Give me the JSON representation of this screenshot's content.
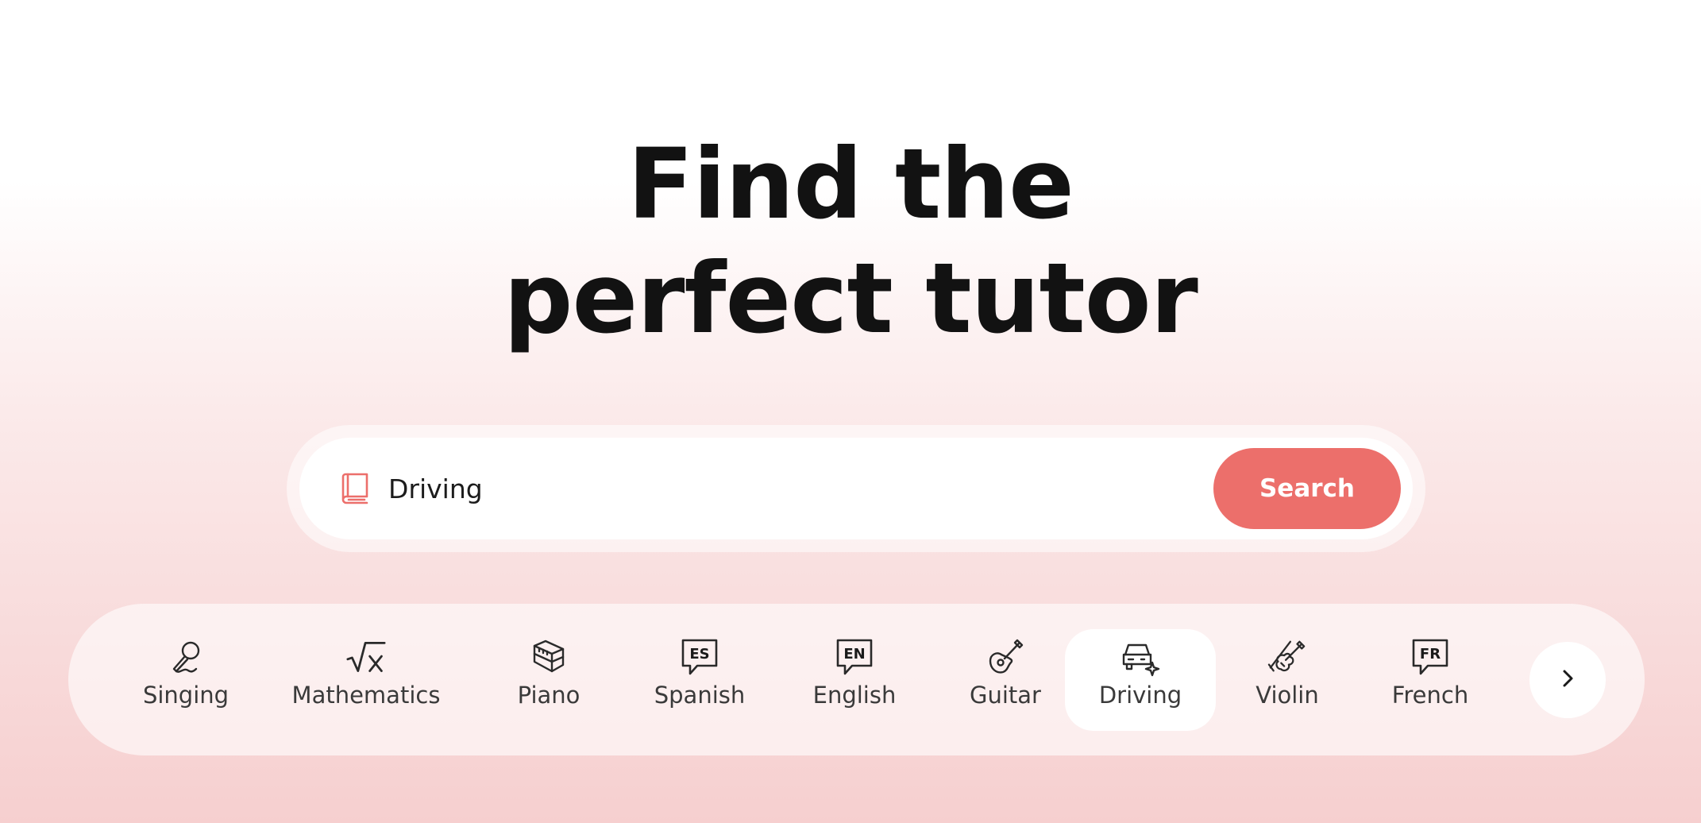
{
  "hero": {
    "line1": "Find the",
    "line2": "perfect tutor"
  },
  "search": {
    "value": "Driving",
    "icon": "book-icon",
    "button_label": "Search"
  },
  "categories": {
    "items": [
      {
        "label": "Singing",
        "icon": "microphone-icon",
        "active": false
      },
      {
        "label": "Mathematics",
        "icon": "square-root-icon",
        "active": false
      },
      {
        "label": "Piano",
        "icon": "piano-icon",
        "active": false
      },
      {
        "label": "Spanish",
        "icon": "speech-bubble-es-icon",
        "badge": "ES",
        "active": false
      },
      {
        "label": "English",
        "icon": "speech-bubble-en-icon",
        "badge": "EN",
        "active": false
      },
      {
        "label": "Guitar",
        "icon": "guitar-icon",
        "active": false
      },
      {
        "label": "Driving",
        "icon": "car-icon",
        "active": true
      },
      {
        "label": "Violin",
        "icon": "violin-icon",
        "active": false
      },
      {
        "label": "French",
        "icon": "speech-bubble-fr-icon",
        "badge": "FR",
        "active": false
      }
    ],
    "next_icon": "chevron-right-icon"
  },
  "colors": {
    "accent": "#ec6f6b",
    "title": "#121212",
    "label": "#3a3a3a"
  }
}
